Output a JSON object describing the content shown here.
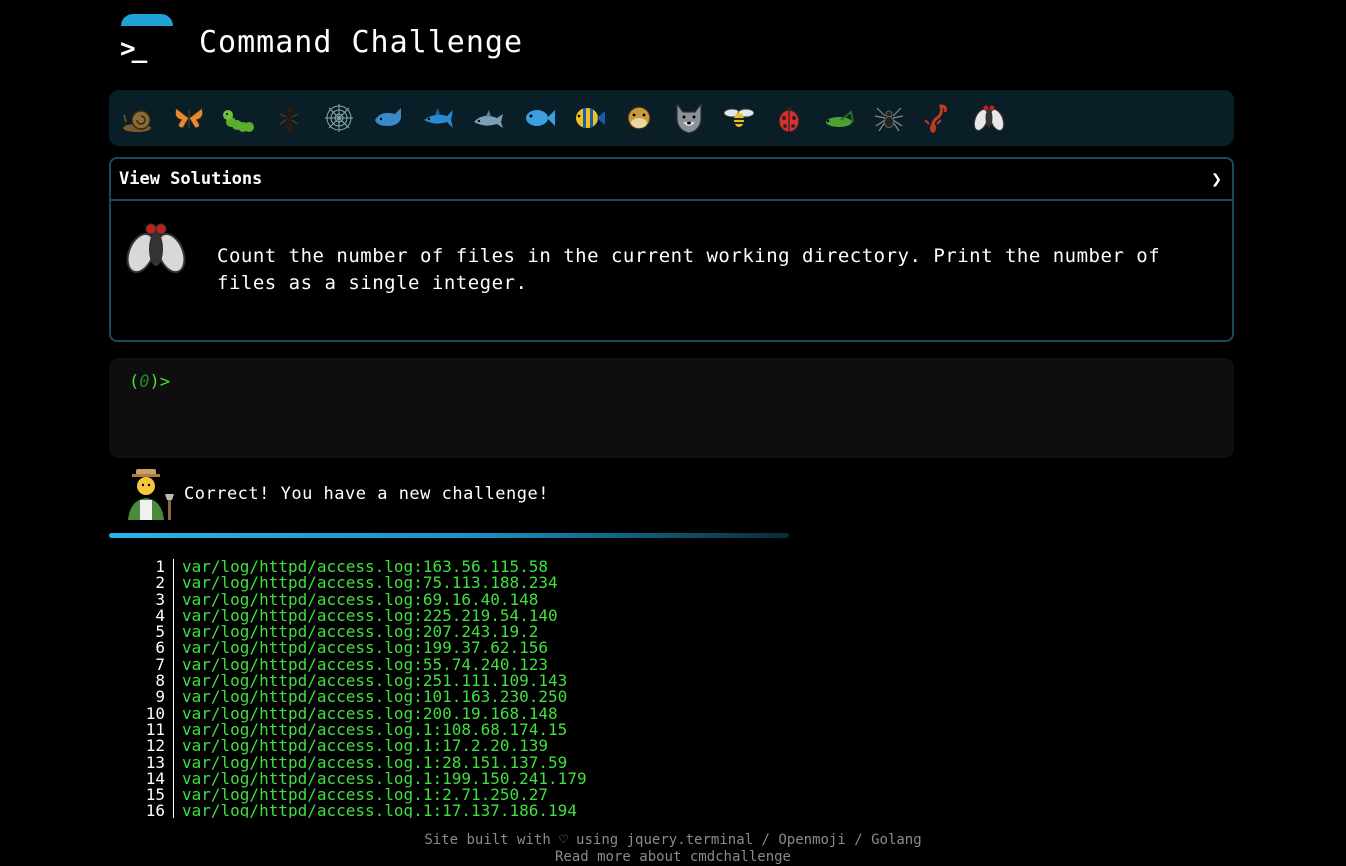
{
  "header": {
    "logo_glyph": ">_",
    "title": "Command Challenge"
  },
  "levels": [
    {
      "icon": "snail-icon"
    },
    {
      "icon": "butterfly-icon"
    },
    {
      "icon": "caterpillar-icon"
    },
    {
      "icon": "ant-icon"
    },
    {
      "icon": "spider-web-icon"
    },
    {
      "icon": "whale-icon"
    },
    {
      "icon": "shark-icon"
    },
    {
      "icon": "dolphin-icon"
    },
    {
      "icon": "fish-icon"
    },
    {
      "icon": "tropical-fish-icon"
    },
    {
      "icon": "blowfish-icon"
    },
    {
      "icon": "wolf-icon"
    },
    {
      "icon": "bee-icon"
    },
    {
      "icon": "ladybug-icon"
    },
    {
      "icon": "cricket-icon"
    },
    {
      "icon": "spider-icon"
    },
    {
      "icon": "scorpion-icon"
    },
    {
      "icon": "fly-icon"
    }
  ],
  "solutions": {
    "label": "View Solutions",
    "chevron": "❯",
    "challenge_icon": "fly-icon",
    "challenge_text": "Count the number of files in the current working directory. Print the number of files as a single integer."
  },
  "terminal": {
    "prompt_open": "(",
    "prompt_count": "0",
    "prompt_close": ")>"
  },
  "result": {
    "icon": "farmer-icon",
    "message": "Correct! You have a new challenge!"
  },
  "output_lines": [
    {
      "n": "1",
      "text": "var/log/httpd/access.log:163.56.115.58"
    },
    {
      "n": "2",
      "text": "var/log/httpd/access.log:75.113.188.234"
    },
    {
      "n": "3",
      "text": "var/log/httpd/access.log:69.16.40.148"
    },
    {
      "n": "4",
      "text": "var/log/httpd/access.log:225.219.54.140"
    },
    {
      "n": "5",
      "text": "var/log/httpd/access.log:207.243.19.2"
    },
    {
      "n": "6",
      "text": "var/log/httpd/access.log:199.37.62.156"
    },
    {
      "n": "7",
      "text": "var/log/httpd/access.log:55.74.240.123"
    },
    {
      "n": "8",
      "text": "var/log/httpd/access.log:251.111.109.143"
    },
    {
      "n": "9",
      "text": "var/log/httpd/access.log:101.163.230.250"
    },
    {
      "n": "10",
      "text": "var/log/httpd/access.log:200.19.168.148"
    },
    {
      "n": "11",
      "text": "var/log/httpd/access.log.1:108.68.174.15"
    },
    {
      "n": "12",
      "text": "var/log/httpd/access.log.1:17.2.20.139"
    },
    {
      "n": "13",
      "text": "var/log/httpd/access.log.1:28.151.137.59"
    },
    {
      "n": "14",
      "text": "var/log/httpd/access.log.1:199.150.241.179"
    },
    {
      "n": "15",
      "text": "var/log/httpd/access.log.1:2.71.250.27"
    },
    {
      "n": "16",
      "text": "var/log/httpd/access.log.1:17.137.186.194"
    }
  ],
  "footer": {
    "prefix": "Site built with ♡ using ",
    "link_terminal": "jquery.terminal",
    "sep1": " / ",
    "link_openmoji": "Openmoji",
    "sep2": " / ",
    "link_golang": "Golang",
    "read_more": "Read more about cmdchallenge"
  },
  "colors": {
    "accent": "#1fa3d6",
    "prompt_green": "#3fe03f",
    "panel": "#0a1e28",
    "border": "#1a4a5c"
  }
}
